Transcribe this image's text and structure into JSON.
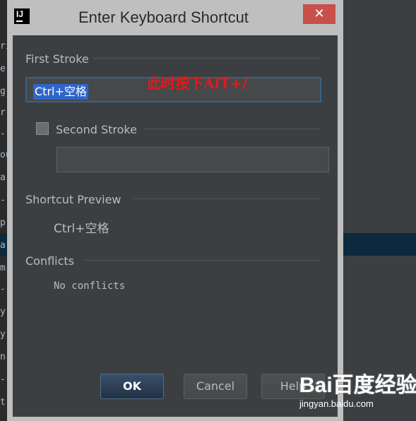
{
  "dialog": {
    "title": "Enter Keyboard Shortcut",
    "close_icon": "close-icon",
    "app_icon": "IJ"
  },
  "first_stroke": {
    "label": "First Stroke",
    "value": "Ctrl+空格"
  },
  "annotation": {
    "text": "此时按下AlT+/",
    "color": "#e8171a"
  },
  "second_stroke": {
    "label": "Second Stroke",
    "checked": false,
    "value": ""
  },
  "shortcut_preview": {
    "label": "Shortcut Preview",
    "value": "Ctrl+空格"
  },
  "conflicts": {
    "label": "Conflicts",
    "value": "No conflicts"
  },
  "buttons": {
    "ok": "OK",
    "cancel": "Cancel",
    "help": "Help"
  },
  "watermark": {
    "logo": "Bai百度经验",
    "url": "jingyan.baidu.com"
  },
  "background_editor": {
    "fragments": [
      "ri",
      "er",
      "g",
      "r",
      "-",
      "ou",
      "a",
      "-",
      "p",
      "a",
      "m",
      "-",
      "y",
      "y",
      "n",
      "-",
      "t"
    ]
  },
  "colors": {
    "dialog_bg": "#3c3f41",
    "titlebar": "#bfbfbf",
    "close_button": "#c7504a",
    "selection": "#2f65ca",
    "focus_border": "#3d6185"
  }
}
